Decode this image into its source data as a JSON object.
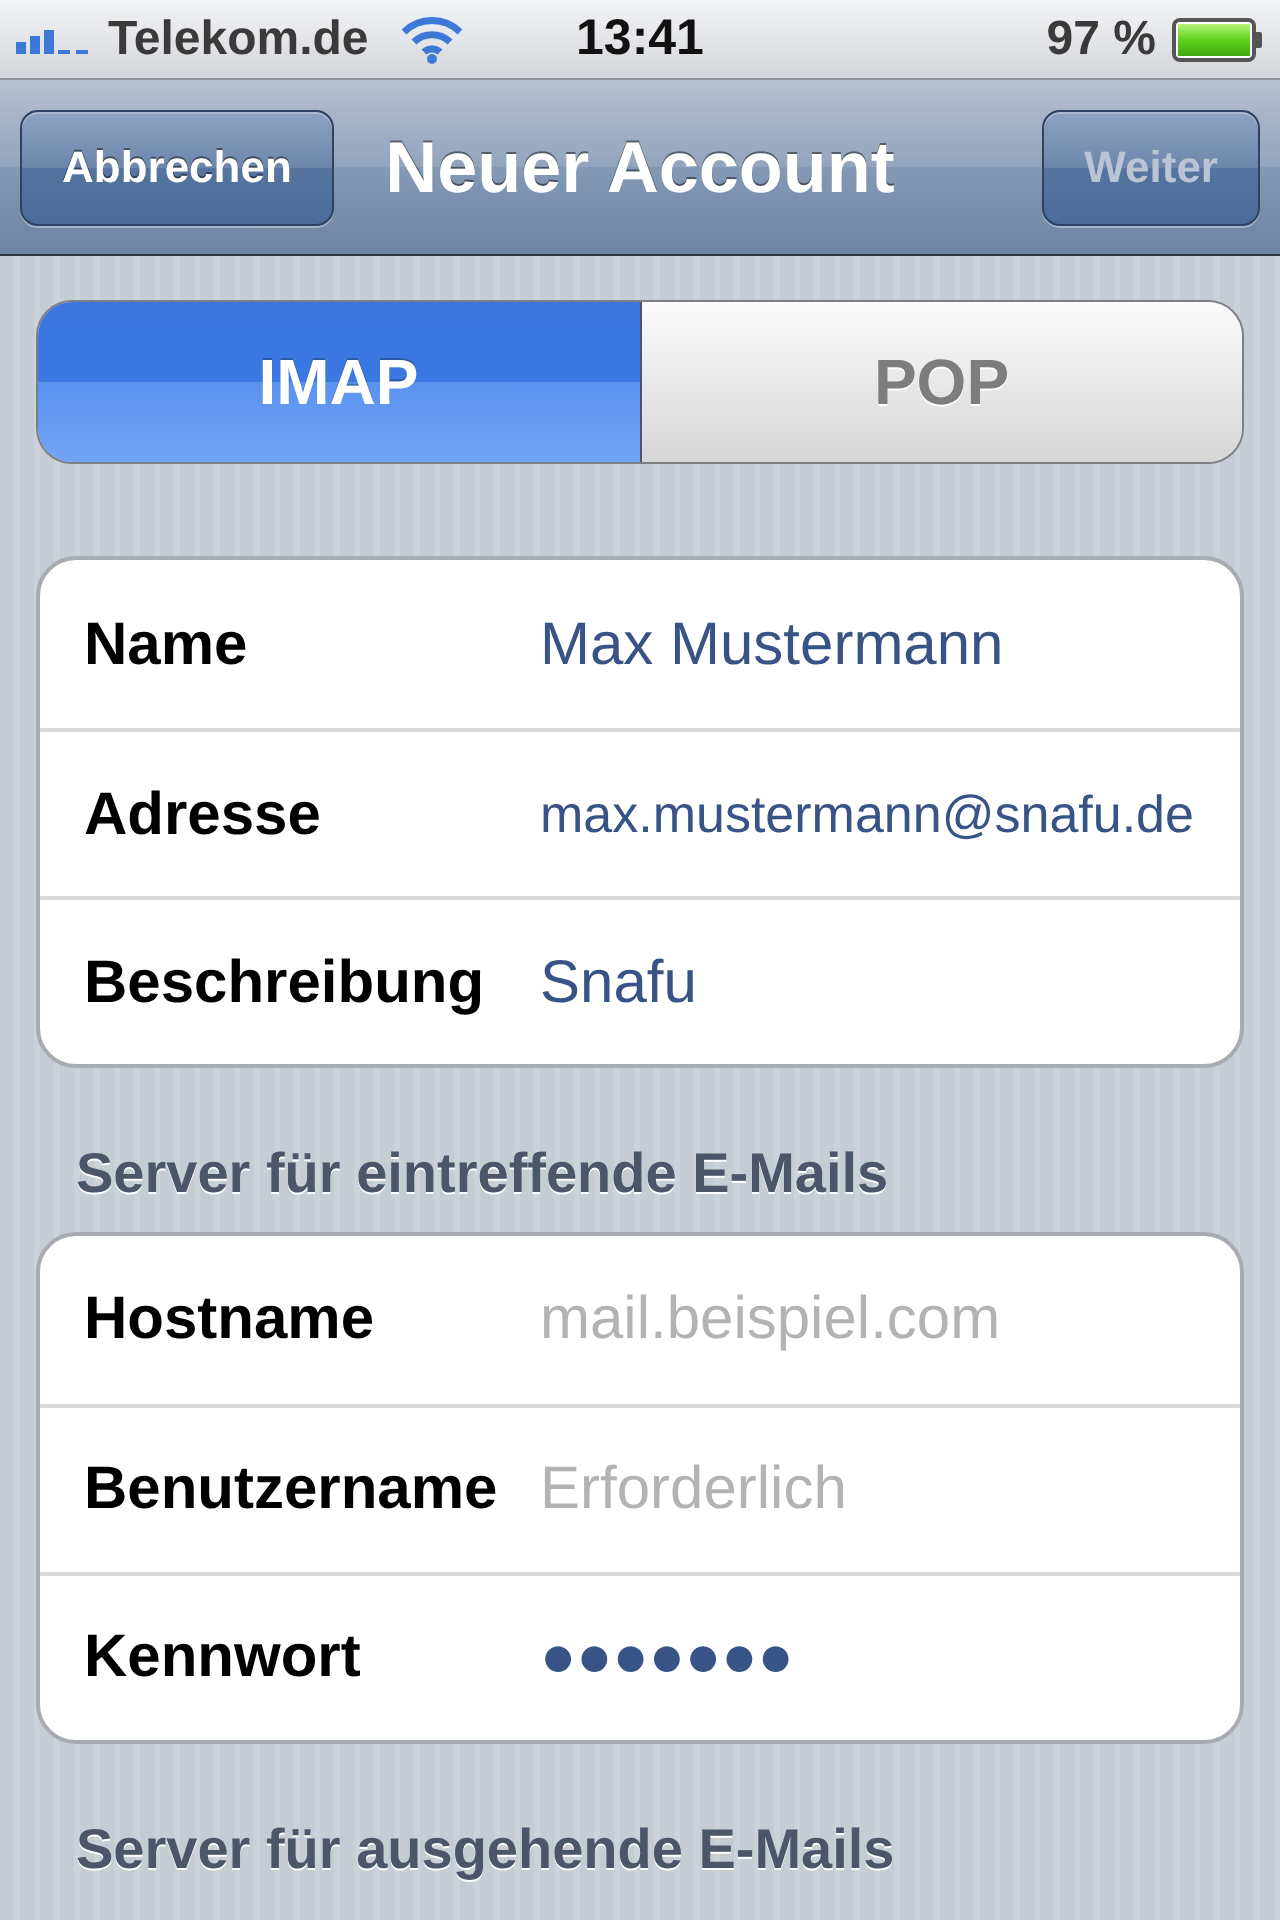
{
  "status_bar": {
    "carrier": "Telekom.de",
    "time": "13:41",
    "battery": "97 %"
  },
  "nav_bar": {
    "title": "Neuer Account",
    "left_button": {
      "label": "Abbrechen",
      "disabled": false
    },
    "right_button": {
      "label": "Weiter",
      "disabled": true
    }
  },
  "account_type": [
    {
      "label": "IMAP",
      "selected": true
    },
    {
      "label": "POP",
      "selected": false
    }
  ],
  "account_fields": [
    {
      "label": "Name",
      "value": "Max Mustermann"
    },
    {
      "label": "Adresse",
      "value": "max.mustermann@snafu.de"
    },
    {
      "label": "Beschreibung",
      "value": "Snafu"
    }
  ],
  "incoming_server": {
    "title": "Server für eintreffende E-Mails",
    "fields": [
      {
        "label": "Hostname",
        "placeholder": "mail.beispiel.com"
      },
      {
        "label": "Benutzername",
        "placeholder": "Erforderlich"
      },
      {
        "label": "Kennwort",
        "value": "●●●●●●●"
      }
    ]
  },
  "outgoing_server": {
    "title": "Server für ausgehende E-Mails"
  }
}
